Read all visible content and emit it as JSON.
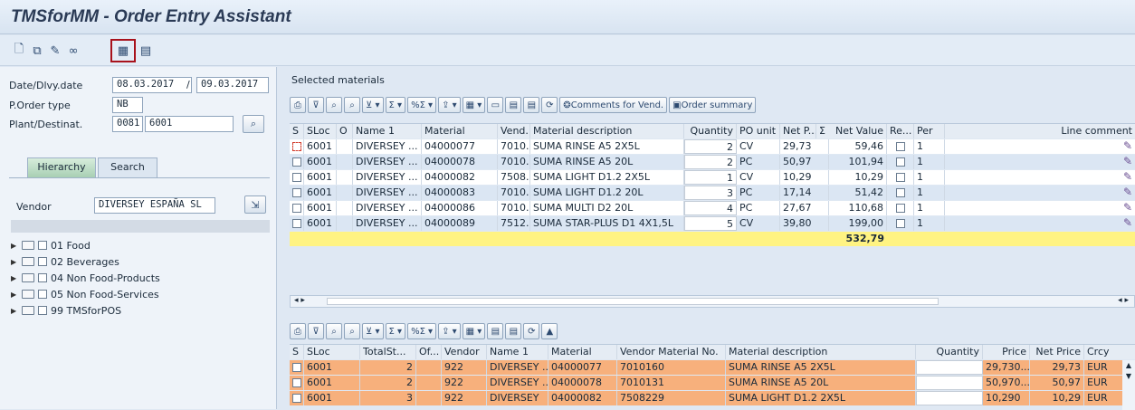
{
  "title": "TMSforMM - Order Entry Assistant",
  "toolbar_icons": [
    "new-document-icon",
    "copy-icon",
    "pencil-icon",
    "glasses-icon",
    "layout-icon",
    "grid-icon"
  ],
  "left": {
    "date_label": "Date/Dlvy.date",
    "date_value": "08.03.2017",
    "date_sep": "/",
    "dlvy_value": "09.03.2017",
    "ordertype_label": "P.Order type",
    "ordertype_value": "NB",
    "plant_label": "Plant/Destinat.",
    "plant_value": "0081",
    "dest_value": "6001",
    "tabs": [
      "Hierarchy",
      "Search"
    ],
    "vendor_label": "Vendor",
    "vendor_value": "DIVERSEY ESPAÑA SL",
    "tree": [
      "01 Food",
      "02 Beverages",
      "04 Non Food-Products",
      "05 Non Food-Services",
      "99 TMSforPOS"
    ]
  },
  "upper": {
    "section_title": "Selected materials",
    "btn_comments": "Comments for Vend.",
    "btn_summary": "Order summary",
    "headers": {
      "s": "S",
      "sloc": "SLoc",
      "o": "O",
      "name1": "Name 1",
      "material": "Material",
      "vend": "Vend...",
      "matdesc": "Material description",
      "qty": "Quantity",
      "pounit": "PO unit",
      "netp": "Net P...",
      "sigma": "Σ",
      "netval": "Net Value",
      "re": "Re...",
      "per": "Per",
      "linecomment": "Line comment"
    },
    "rows": [
      {
        "sloc": "6001",
        "name1": "DIVERSEY ...",
        "material": "04000077",
        "vend": "7010...",
        "desc": "SUMA RINSE A5 2X5L",
        "qty": "2",
        "unit": "CV",
        "netp": "29,73",
        "netval": "59,46",
        "per": "1"
      },
      {
        "sloc": "6001",
        "name1": "DIVERSEY ...",
        "material": "04000078",
        "vend": "7010...",
        "desc": "SUMA RINSE A5 20L",
        "qty": "2",
        "unit": "PC",
        "netp": "50,97",
        "netval": "101,94",
        "per": "1"
      },
      {
        "sloc": "6001",
        "name1": "DIVERSEY ...",
        "material": "04000082",
        "vend": "7508...",
        "desc": "SUMA LIGHT D1.2 2X5L",
        "qty": "1",
        "unit": "CV",
        "netp": "10,29",
        "netval": "10,29",
        "per": "1"
      },
      {
        "sloc": "6001",
        "name1": "DIVERSEY ...",
        "material": "04000083",
        "vend": "7010...",
        "desc": "SUMA LIGHT D1.2 20L",
        "qty": "3",
        "unit": "PC",
        "netp": "17,14",
        "netval": "51,42",
        "per": "1"
      },
      {
        "sloc": "6001",
        "name1": "DIVERSEY ...",
        "material": "04000086",
        "vend": "7010...",
        "desc": "SUMA MULTI D2 20L",
        "qty": "4",
        "unit": "PC",
        "netp": "27,67",
        "netval": "110,68",
        "per": "1"
      },
      {
        "sloc": "6001",
        "name1": "DIVERSEY ...",
        "material": "04000089",
        "vend": "7512...",
        "desc": "SUMA STAR-PLUS D1 4X1,5L",
        "qty": "5",
        "unit": "CV",
        "netp": "39,80",
        "netval": "199,00",
        "per": "1"
      }
    ],
    "total": "532,79"
  },
  "lower": {
    "headers": {
      "s": "S",
      "sloc": "SLoc",
      "totalst": "TotalSt...",
      "of": "Of...",
      "vendor": "Vendor",
      "name1": "Name 1",
      "material": "Material",
      "vendmat": "Vendor Material No.",
      "matdesc": "Material description",
      "qty": "Quantity",
      "price": "Price",
      "netprice": "Net Price",
      "crcy": "Crcy"
    },
    "rows": [
      {
        "sloc": "6001",
        "totalst": "2",
        "vendor": "922",
        "name1": "DIVERSEY ...",
        "material": "04000077",
        "vendmat": "7010160",
        "desc": "SUMA RINSE A5 2X5L",
        "price": "29,730...",
        "netprice": "29,73",
        "crcy": "EUR"
      },
      {
        "sloc": "6001",
        "totalst": "2",
        "vendor": "922",
        "name1": "DIVERSEY ...",
        "material": "04000078",
        "vendmat": "7010131",
        "desc": "SUMA RINSE A5 20L",
        "price": "50,970...",
        "netprice": "50,97",
        "crcy": "EUR"
      },
      {
        "sloc": "6001",
        "totalst": "3",
        "vendor": "922",
        "name1": "DIVERSEY",
        "material": "04000082",
        "vendmat": "7508229",
        "desc": "SUMA LIGHT D1.2 2X5L",
        "price": "10,290",
        "netprice": "10,29",
        "crcy": "EUR"
      }
    ]
  },
  "colors": {
    "yellow": "#fff382",
    "orange": "#f7b07c",
    "blue": "#dbe6f3",
    "selected_border": "#a8121c"
  }
}
